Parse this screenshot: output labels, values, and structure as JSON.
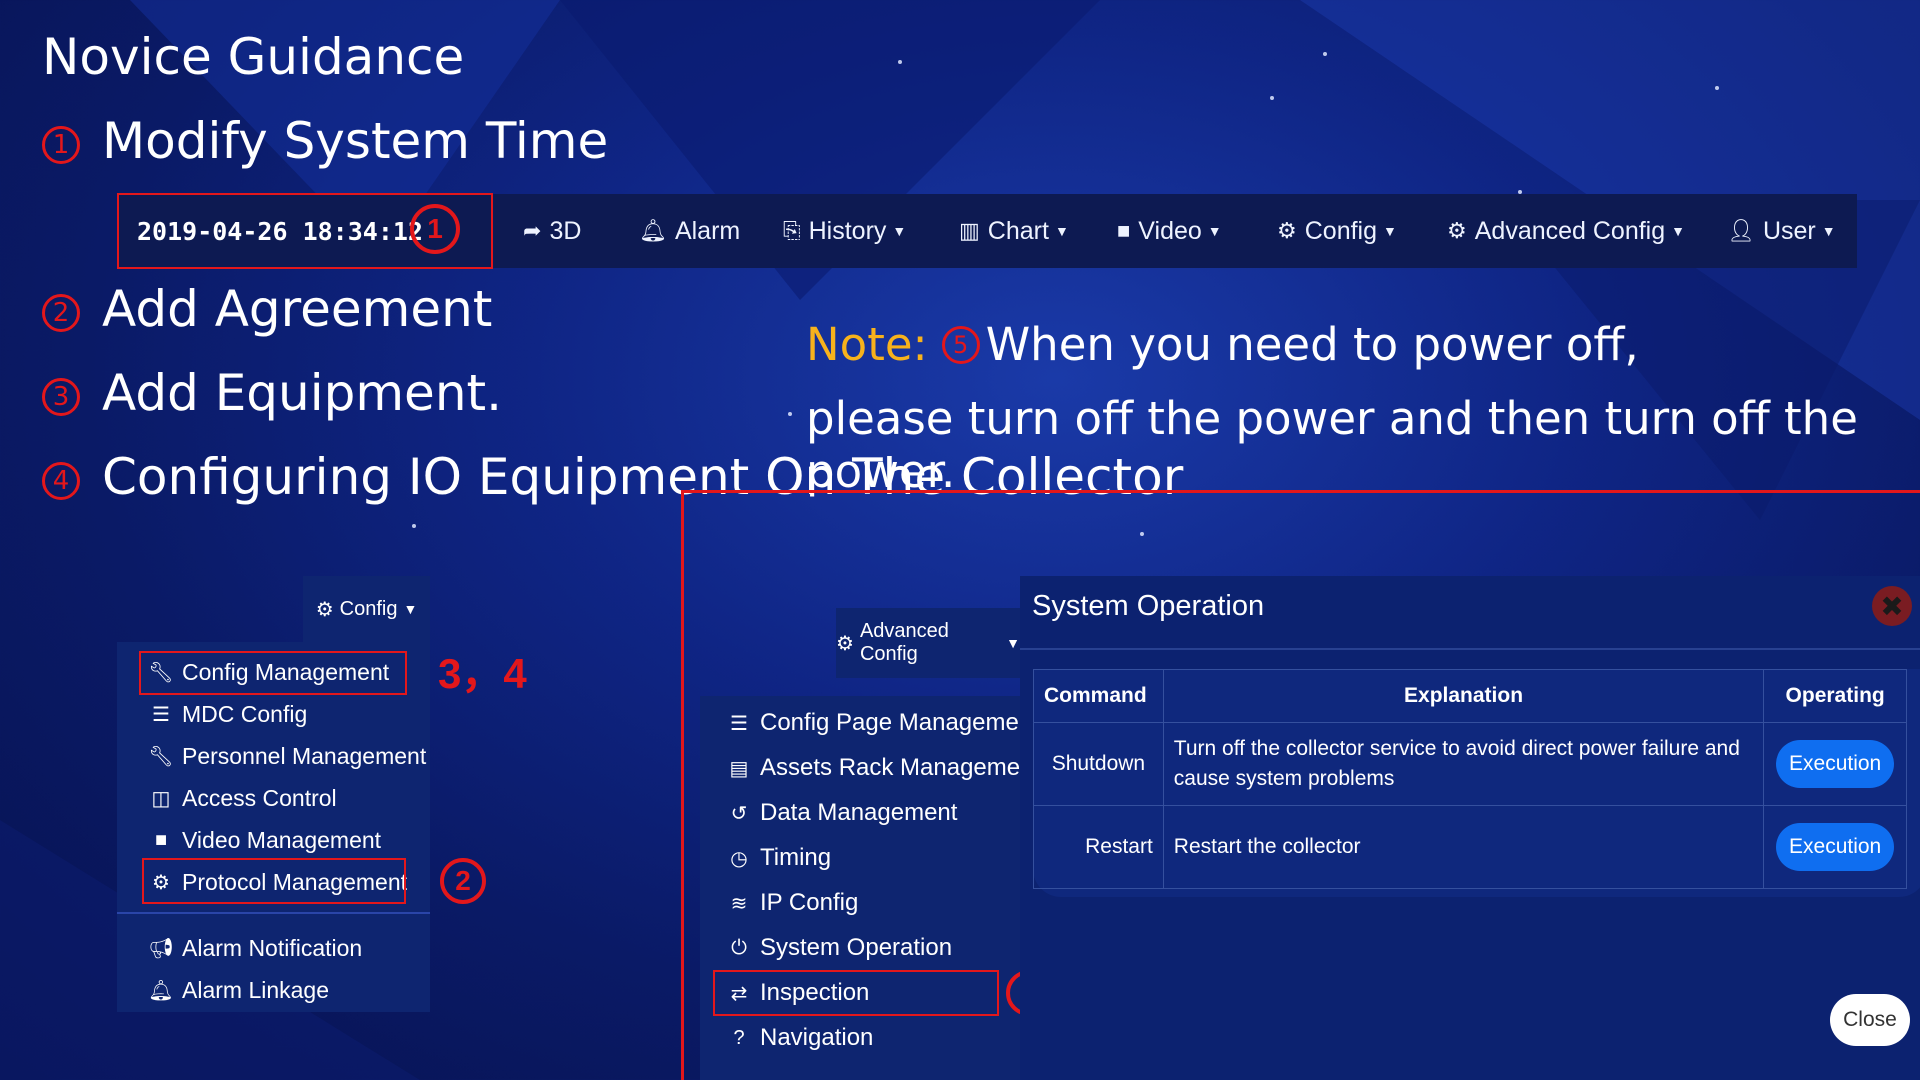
{
  "guide": {
    "title": "Novice Guidance",
    "steps": [
      {
        "num": "1",
        "text": "Modify System Time"
      },
      {
        "num": "2",
        "text": "Add Agreement"
      },
      {
        "num": "3",
        "text": "Add Equipment."
      },
      {
        "num": "4",
        "text": "Configuring IO Equipment On The Collector"
      }
    ],
    "note_label": "Note:",
    "note_num": "5",
    "note_line1": "When you need to power off,",
    "note_line2": "please turn off the power and then turn off the power."
  },
  "navbar": {
    "datetime": "2019-04-26 18:34:12",
    "items": [
      {
        "icon": "share-icon",
        "label": "3D",
        "dropdown": false
      },
      {
        "icon": "bell-icon",
        "label": "Alarm",
        "dropdown": false
      },
      {
        "icon": "history-icon",
        "label": "History",
        "dropdown": true
      },
      {
        "icon": "bar-chart-icon",
        "label": "Chart",
        "dropdown": true
      },
      {
        "icon": "video-icon",
        "label": "Video",
        "dropdown": true
      },
      {
        "icon": "gear-icon",
        "label": "Config",
        "dropdown": true
      },
      {
        "icon": "gears-icon",
        "label": "Advanced Config",
        "dropdown": true
      },
      {
        "icon": "user-icon",
        "label": "User",
        "dropdown": true
      }
    ]
  },
  "markers": {
    "m1": "1",
    "m34": "3，4",
    "m2": "2",
    "m5": "5"
  },
  "config_menu": {
    "header": "Config",
    "items": [
      {
        "icon": "wrench-icon",
        "label": "Config Management"
      },
      {
        "icon": "list-icon",
        "label": "MDC Config"
      },
      {
        "icon": "wrench-icon",
        "label": "Personnel Management"
      },
      {
        "icon": "columns-icon",
        "label": "Access Control"
      },
      {
        "icon": "video-icon",
        "label": "Video Management"
      },
      {
        "icon": "gears-icon",
        "label": "Protocol Management"
      },
      {
        "icon": "bullhorn-icon",
        "label": "Alarm Notification"
      },
      {
        "icon": "bell-icon",
        "label": "Alarm Linkage"
      }
    ]
  },
  "advanced_menu": {
    "header": "Advanced Config",
    "items": [
      {
        "icon": "list-icon",
        "label": "Config Page Management"
      },
      {
        "icon": "server-icon",
        "label": "Assets Rack Management"
      },
      {
        "icon": "history-icon",
        "label": "Data Management"
      },
      {
        "icon": "clock-icon",
        "label": "Timing"
      },
      {
        "icon": "rss-icon",
        "label": "IP Config"
      },
      {
        "icon": "power-icon",
        "label": "System Operation"
      },
      {
        "icon": "retweet-icon",
        "label": "Inspection"
      },
      {
        "icon": "question-icon",
        "label": "Navigation"
      }
    ]
  },
  "dialog": {
    "title": "System Operation",
    "headers": [
      "Command",
      "Explanation",
      "Operating"
    ],
    "rows": [
      {
        "command": "Shutdown",
        "explanation": "Turn off the collector service to avoid direct power failure and cause system problems",
        "action": "Execution"
      },
      {
        "command": "Restart",
        "explanation": "Restart the collector",
        "action": "Execution"
      }
    ],
    "close_label": "Close"
  },
  "colors": {
    "background": "#0f2585",
    "accent_red": "#e3171b",
    "note_yellow": "#f7b21c",
    "button_blue": "#0f6ef0"
  }
}
